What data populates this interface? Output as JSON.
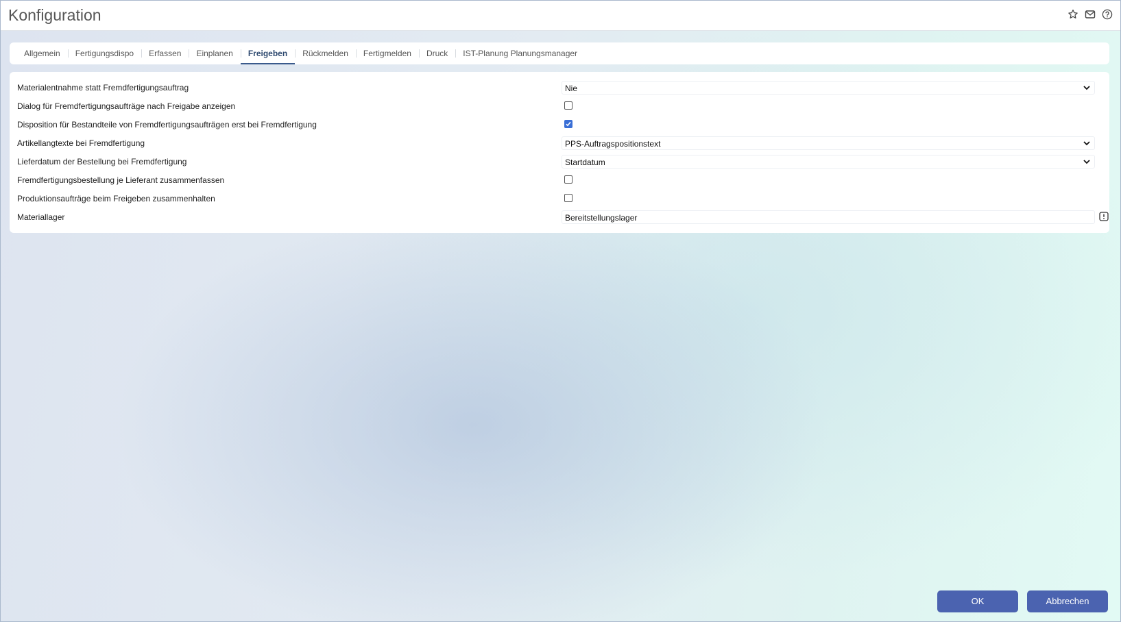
{
  "window": {
    "title": "Konfiguration"
  },
  "header_icons": [
    "star-icon",
    "mail-icon",
    "help-icon"
  ],
  "tabs": [
    {
      "label": "Allgemein",
      "active": false
    },
    {
      "label": "Fertigungsdispo",
      "active": false
    },
    {
      "label": "Erfassen",
      "active": false
    },
    {
      "label": "Einplanen",
      "active": false
    },
    {
      "label": "Freigeben",
      "active": true
    },
    {
      "label": "Rückmelden",
      "active": false
    },
    {
      "label": "Fertigmelden",
      "active": false
    },
    {
      "label": "Druck",
      "active": false
    },
    {
      "label": "IST-Planung Planungsmanager",
      "active": false
    }
  ],
  "settings": [
    {
      "label": "Materialentnahme statt Fremdfertigungsauftrag",
      "type": "select",
      "value": "Nie"
    },
    {
      "label": "Dialog für Fremdfertigungsaufträge nach Freigabe anzeigen",
      "type": "checkbox",
      "checked": false
    },
    {
      "label": "Disposition für Bestandteile von Fremdfertigungsaufträgen erst bei Fremdfertigung",
      "type": "checkbox",
      "checked": true
    },
    {
      "label": "Artikellangtexte bei Fremdfertigung",
      "type": "select",
      "value": "PPS-Auftragspositionstext"
    },
    {
      "label": "Lieferdatum der Bestellung bei Fremdfertigung",
      "type": "select",
      "value": "Startdatum"
    },
    {
      "label": "Fremdfertigungsbestellung je Lieferant zusammenfassen",
      "type": "checkbox",
      "checked": false
    },
    {
      "label": "Produktionsaufträge beim Freigeben zusammenhalten",
      "type": "checkbox",
      "checked": false
    },
    {
      "label": "Materiallager",
      "type": "lookup",
      "value": "Bereitstellungslager"
    }
  ],
  "footer": {
    "ok_label": "OK",
    "cancel_label": "Abbrechen"
  },
  "colors": {
    "accent": "#4b63b0",
    "checkbox": "#3a6fd6",
    "active_tab": "#2f4a70"
  }
}
